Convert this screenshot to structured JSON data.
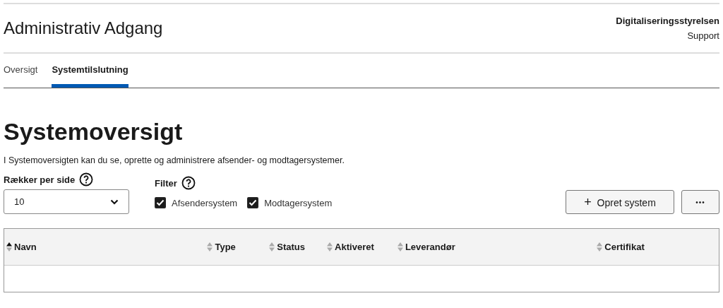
{
  "header": {
    "title": "Administrativ Adgang",
    "organization": "Digitaliseringsstyrelsen",
    "support_link": "Support"
  },
  "tabs": [
    {
      "label": "Oversigt",
      "selected": false
    },
    {
      "label": "Systemtilslutning",
      "selected": true
    }
  ],
  "page": {
    "heading": "Systemoversigt",
    "description": "I Systemoversigten kan du se, oprette og administrere afsender- og modtagersystemer."
  },
  "rows_per_page": {
    "label": "Rækker per side",
    "value": "10"
  },
  "filter": {
    "label": "Filter",
    "options": [
      {
        "label": "Afsendersystem",
        "checked": true
      },
      {
        "label": "Modtagersystem",
        "checked": true
      }
    ]
  },
  "create_button": {
    "icon": "+",
    "label": "Opret system"
  },
  "more_button": {
    "label": "•••"
  },
  "table": {
    "columns": [
      {
        "label": "Navn",
        "sorted_ascending": true
      },
      {
        "label": "Type",
        "sorted_ascending": false
      },
      {
        "label": "Status",
        "sorted_ascending": false
      },
      {
        "label": "Aktiveret",
        "sorted_ascending": false
      },
      {
        "label": "Leverandør",
        "sorted_ascending": false
      },
      {
        "label": "Certifikat",
        "sorted_ascending": false
      }
    ]
  }
}
